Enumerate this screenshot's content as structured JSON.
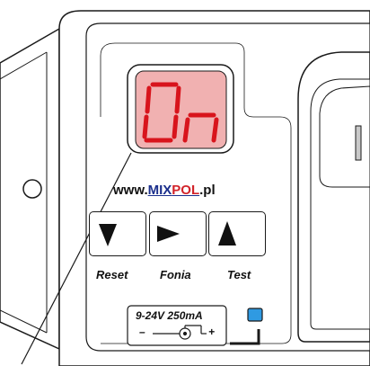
{
  "display": {
    "text": "On"
  },
  "website": {
    "prefix": "www.",
    "brand_blue": "MIX",
    "brand_red": "POL",
    "suffix": ".pl"
  },
  "buttons": [
    {
      "label": "Reset",
      "icon": "triangle-down-icon"
    },
    {
      "label": "Fonia",
      "icon": "triangle-right-icon"
    },
    {
      "label": "Test",
      "icon": "triangle-up-icon"
    }
  ],
  "power": {
    "spec": "9-24V 250mA",
    "minus": "–",
    "plus": "+"
  },
  "colors": {
    "display_bg": "#f1b1b1",
    "segment": "#d8141c",
    "led": "#2f9ae2",
    "brand_blue": "#1b2f8c",
    "brand_red": "#d2232a"
  }
}
